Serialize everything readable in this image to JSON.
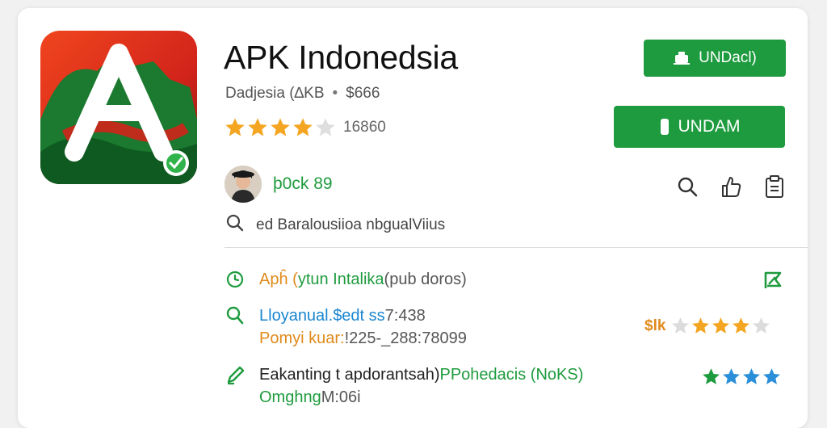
{
  "app": {
    "title": "APK Indonedsia",
    "developer_line": "Dadjesia (∆KB",
    "separator": "•",
    "price": "$666",
    "rating_stars": 4,
    "rating_max": 5,
    "rating_count": "16860",
    "accent_color": "#1e9b3e"
  },
  "buttons": {
    "primary_label": "UNDacl)",
    "secondary_label": "UNDAM"
  },
  "developer": {
    "name": "þ0ck 89"
  },
  "toolbar": {
    "icons": [
      "search-icon",
      "thumbs-up-icon",
      "clipboard-icon"
    ]
  },
  "search": {
    "text": "ed Baralousiioa nbgualViius"
  },
  "details": {
    "row1": {
      "icon": "clock-icon",
      "part1": "Apĥ (",
      "part2": "ytun Intalika",
      "part3": " (pub doros)"
    },
    "row2": {
      "icon": "search-icon",
      "part1": "Lloyanual. ",
      "part2": "$edt ss",
      "part3": " 7:438"
    },
    "row3": {
      "part1": "Pomyi kuar: ",
      "part2": "!225-_288:78099"
    },
    "row4": {
      "icon": "pencil-icon",
      "part1": "Eakanting t apdorantsah) ",
      "part2": "PPohedacis (NoKS)"
    },
    "row5": {
      "part1": "Omghng ",
      "part2": "M:06i"
    }
  },
  "right_ratings": {
    "first": {
      "label": "$lk",
      "stars": 3,
      "max": 5
    },
    "second": {
      "stars": 4,
      "max": 4
    }
  }
}
